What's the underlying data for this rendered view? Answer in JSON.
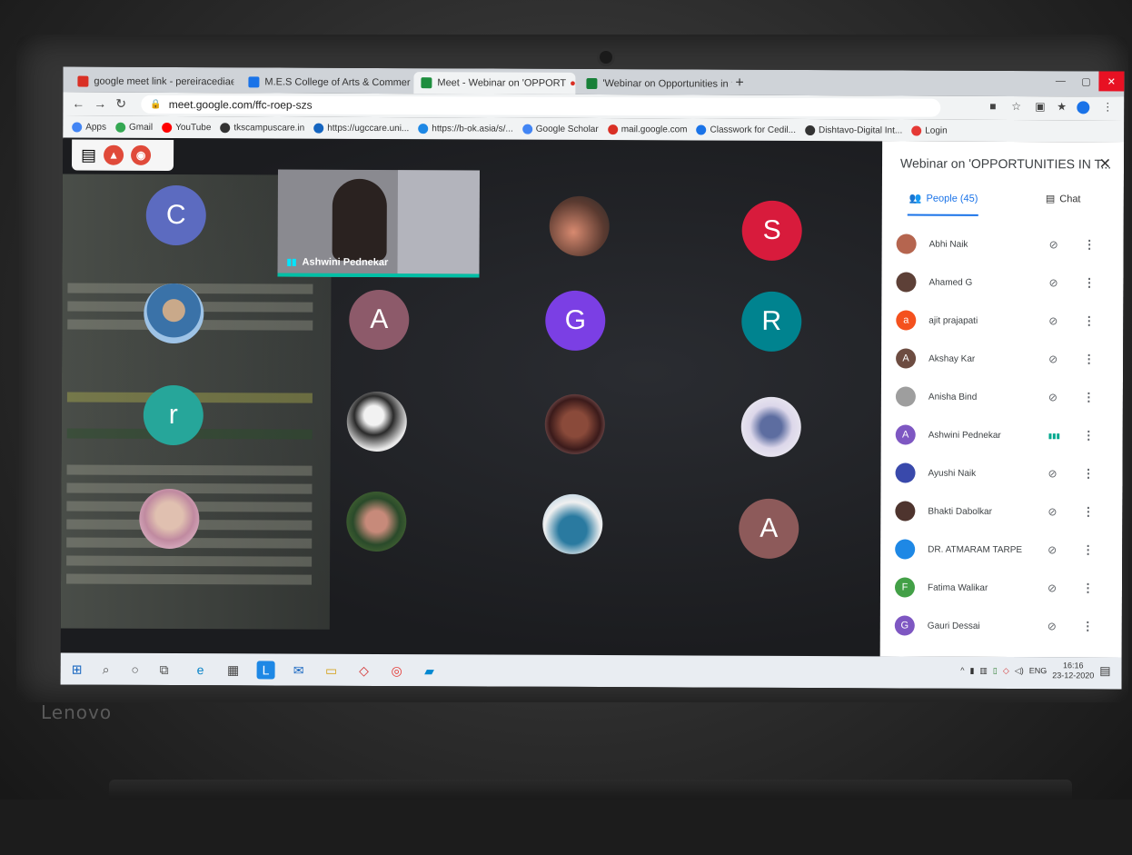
{
  "laptop_brand": "Lenovo",
  "browser": {
    "tabs": [
      {
        "label": "google meet link - pereiracediae",
        "color": "#d93025"
      },
      {
        "label": "M.E.S College of Arts & Commer",
        "color": "#1a73e8"
      },
      {
        "label": "Meet - Webinar on 'OPPORT",
        "color": "#1e8e3e"
      },
      {
        "label": "'Webinar on Opportunities in the",
        "color": "#188038"
      }
    ],
    "url": "meet.google.com/ffc-roep-szs",
    "bookmarks": [
      {
        "label": "Apps",
        "color": "#4285f4"
      },
      {
        "label": "Gmail",
        "color": "#34a853"
      },
      {
        "label": "YouTube",
        "color": "#ff0000"
      },
      {
        "label": "tkscampuscare.in",
        "color": "#333333"
      },
      {
        "label": "https://ugccare.uni...",
        "color": "#1565c0"
      },
      {
        "label": "https://b-ok.asia/s/...",
        "color": "#1e88e5"
      },
      {
        "label": "Google Scholar",
        "color": "#4285f4"
      },
      {
        "label": "mail.google.com",
        "color": "#d93025"
      },
      {
        "label": "Classwork for Cedil...",
        "color": "#1a73e8"
      },
      {
        "label": "Dishtavo-Digital Int...",
        "color": "#333333"
      },
      {
        "label": "Login",
        "color": "#e53935"
      }
    ]
  },
  "meet": {
    "speaker_name": "Ashwini Pednekar",
    "grid": [
      {
        "letter": "C",
        "color": "#5c6bc0"
      },
      {
        "letter": "S",
        "color": "#d81b3c"
      },
      {
        "letter": "A",
        "color": "#8d5a6a"
      },
      {
        "letter": "G",
        "color": "#7b3fe4"
      },
      {
        "letter": "R",
        "color": "#00838f"
      },
      {
        "letter": "r",
        "color": "#26a69a"
      },
      {
        "letter": "A",
        "color": "#8d5a5a"
      }
    ],
    "panel": {
      "title": "Webinar on 'OPPORTUNITIES IN T...",
      "people_tab": "People (45)",
      "chat_tab": "Chat",
      "people": [
        {
          "name": "Abhi Naik",
          "initial": "",
          "color": "#b5654f",
          "speaking": false
        },
        {
          "name": "Ahamed G",
          "initial": "",
          "color": "#5d4037",
          "speaking": false
        },
        {
          "name": "ajit prajapati",
          "initial": "a",
          "color": "#f4511e",
          "speaking": false
        },
        {
          "name": "Akshay Kar",
          "initial": "A",
          "color": "#6d4c41",
          "speaking": false
        },
        {
          "name": "Anisha Bind",
          "initial": "",
          "color": "#9e9e9e",
          "speaking": false
        },
        {
          "name": "Ashwini Pednekar",
          "initial": "A",
          "color": "#7e57c2",
          "speaking": true
        },
        {
          "name": "Ayushi Naik",
          "initial": "",
          "color": "#3949ab",
          "speaking": false
        },
        {
          "name": "Bhakti Dabolkar",
          "initial": "",
          "color": "#4e342e",
          "speaking": false
        },
        {
          "name": "DR. ATMARAM TARPE",
          "initial": "",
          "color": "#1e88e5",
          "speaking": false
        },
        {
          "name": "Fatima Walikar",
          "initial": "F",
          "color": "#43a047",
          "speaking": false
        },
        {
          "name": "Gauri Dessai",
          "initial": "G",
          "color": "#7e57c2",
          "speaking": false
        }
      ]
    }
  },
  "taskbar": {
    "lang": "ENG",
    "time": "16:16",
    "date": "23-12-2020"
  }
}
